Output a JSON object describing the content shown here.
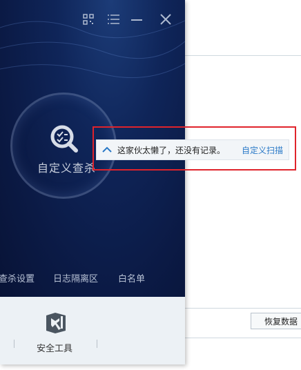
{
  "background_window": {
    "restore_button": "恢复数据"
  },
  "titlebar": {
    "icons": [
      "qr-code-icon",
      "menu-icon",
      "minimize-icon",
      "close-icon"
    ]
  },
  "scan": {
    "label": "自定义查杀",
    "icon": "scan-check-icon"
  },
  "bottom_links": [
    "查杀设置",
    "日志隔离区",
    "白名单"
  ],
  "footer": {
    "tool_label": "安全工具",
    "tool_icon": "wrench-shield-icon"
  },
  "popup": {
    "message": "这家伙太懒了，还没有记录。",
    "link": "自定义扫描",
    "icon": "chevron-up-icon"
  },
  "colors": {
    "panel_bg": "#0d1e4b",
    "link_blue": "#2a79c7",
    "highlight_red": "#e0232b",
    "footer_bg": "#ecf1f5"
  }
}
